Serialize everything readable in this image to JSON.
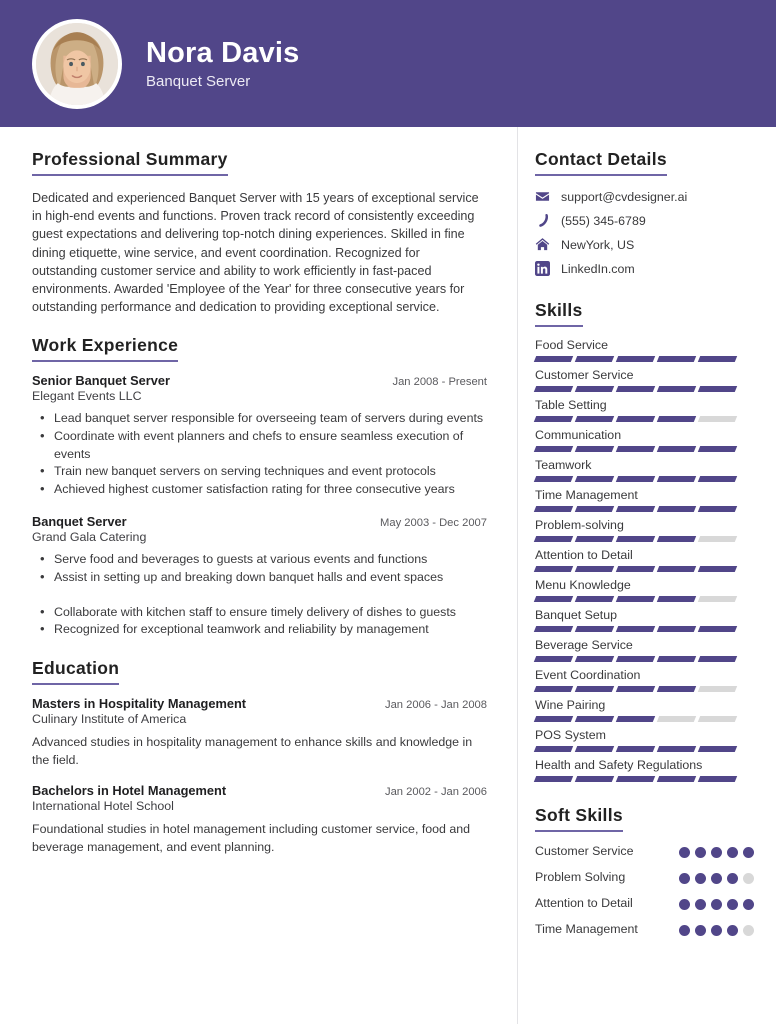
{
  "theme": {
    "header_bg": "#514689",
    "accent": "#514689",
    "accent_underline": "#6f65a6",
    "empty_track": "#d8d8d8",
    "body_text": "#3a3a3c"
  },
  "header": {
    "name": "Nora Davis",
    "job_title": "Banquet Server",
    "avatar_icon": "profile-photo-woman"
  },
  "summary": {
    "title": "Professional Summary",
    "text": "Dedicated and experienced Banquet Server with 15 years of exceptional service in high-end events and functions. Proven track record of consistently exceeding guest expectations and delivering top-notch dining experiences. Skilled in fine dining etiquette, wine service, and event coordination. Recognized for outstanding customer service and ability to work efficiently in fast-paced environments. Awarded 'Employee of the Year' for three consecutive years for outstanding performance and dedication to providing exceptional service."
  },
  "work_experience": {
    "title": "Work Experience",
    "entries": [
      {
        "role": "Senior Banquet Server",
        "date": "Jan 2008 - Present",
        "organization": "Elegant Events LLC",
        "bullets": [
          "Lead banquet server responsible for overseeing team of servers during events",
          "Coordinate with event planners and chefs to ensure seamless execution of events",
          "Train new banquet servers on serving techniques and event protocols",
          "Achieved highest customer satisfaction rating for three consecutive years"
        ]
      },
      {
        "role": "Banquet Server",
        "date": "May 2003 - Dec 2007",
        "organization": "Grand Gala Catering",
        "bullets": [
          "Serve food and beverages to guests at various events and functions",
          "Assist in setting up and breaking down banquet halls and event spaces",
          "",
          "Collaborate with kitchen staff to ensure timely delivery of dishes to guests",
          "Recognized for exceptional teamwork and reliability by management"
        ]
      }
    ]
  },
  "education": {
    "title": "Education",
    "entries": [
      {
        "degree": "Masters in Hospitality Management",
        "date": "Jan 2006 - Jan 2008",
        "school": "Culinary Institute of America",
        "description": "Advanced studies in hospitality management to enhance skills and knowledge in the field."
      },
      {
        "degree": "Bachelors in Hotel Management",
        "date": "Jan 2002 - Jan 2006",
        "school": "International Hotel School",
        "description": "Foundational studies in hotel management including customer service, food and beverage management, and event planning."
      }
    ]
  },
  "contact": {
    "title": "Contact Details",
    "items": [
      {
        "icon": "envelope-icon",
        "value": "support@cvdesigner.ai"
      },
      {
        "icon": "phone-icon",
        "value": "(555) 345-6789"
      },
      {
        "icon": "home-icon",
        "value": "NewYork, US"
      },
      {
        "icon": "linkedin-icon",
        "value": "LinkedIn.com"
      }
    ]
  },
  "skills": {
    "title": "Skills",
    "max_level": 5,
    "items": [
      {
        "name": "Food Service",
        "level": 5
      },
      {
        "name": "Customer Service",
        "level": 5
      },
      {
        "name": "Table Setting",
        "level": 4
      },
      {
        "name": "Communication",
        "level": 5
      },
      {
        "name": "Teamwork",
        "level": 5
      },
      {
        "name": "Time Management",
        "level": 5
      },
      {
        "name": "Problem-solving",
        "level": 4
      },
      {
        "name": "Attention to Detail",
        "level": 5
      },
      {
        "name": "Menu Knowledge",
        "level": 4
      },
      {
        "name": "Banquet Setup",
        "level": 5
      },
      {
        "name": "Beverage Service",
        "level": 5
      },
      {
        "name": "Event Coordination",
        "level": 4
      },
      {
        "name": "Wine Pairing",
        "level": 3
      },
      {
        "name": "POS System",
        "level": 5
      },
      {
        "name": "Health and Safety Regulations",
        "level": 5
      }
    ]
  },
  "soft_skills": {
    "title": "Soft Skills",
    "max_level": 5,
    "items": [
      {
        "name": "Customer Service",
        "level": 5
      },
      {
        "name": "Problem Solving",
        "level": 4
      },
      {
        "name": "Attention to Detail",
        "level": 5
      },
      {
        "name": "Time Management",
        "level": 4
      }
    ]
  }
}
